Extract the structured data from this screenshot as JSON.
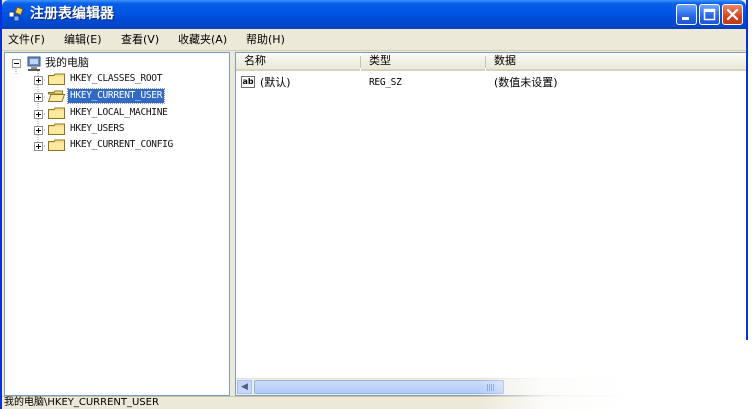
{
  "window": {
    "title": "注册表编辑器",
    "icon": "registry-editor-icon"
  },
  "titlebar_buttons": [
    "minimize-icon",
    "maximize-icon",
    "close-icon"
  ],
  "menu": {
    "file": "文件(F)",
    "edit": "编辑(E)",
    "view": "查看(V)",
    "favorites": "收藏夹(A)",
    "help": "帮助(H)"
  },
  "tree": {
    "root": "我的电脑",
    "hives": [
      {
        "label": "HKEY_CLASSES_ROOT",
        "selected": false
      },
      {
        "label": "HKEY_CURRENT_USER",
        "selected": true
      },
      {
        "label": "HKEY_LOCAL_MACHINE",
        "selected": false
      },
      {
        "label": "HKEY_USERS",
        "selected": false
      },
      {
        "label": "HKEY_CURRENT_CONFIG",
        "selected": false
      }
    ]
  },
  "list": {
    "columns": [
      "名称",
      "类型",
      "数据"
    ],
    "rows": [
      {
        "name": "(默认)",
        "type": "REG_SZ",
        "data": "(数值未设置)",
        "icon": "string-value-icon"
      }
    ]
  },
  "status": {
    "path": "我的电脑\\HKEY_CURRENT_USER"
  },
  "colors": {
    "titlebar": "#0054e3",
    "selection": "#316ac5",
    "window_face": "#ece9d8"
  }
}
